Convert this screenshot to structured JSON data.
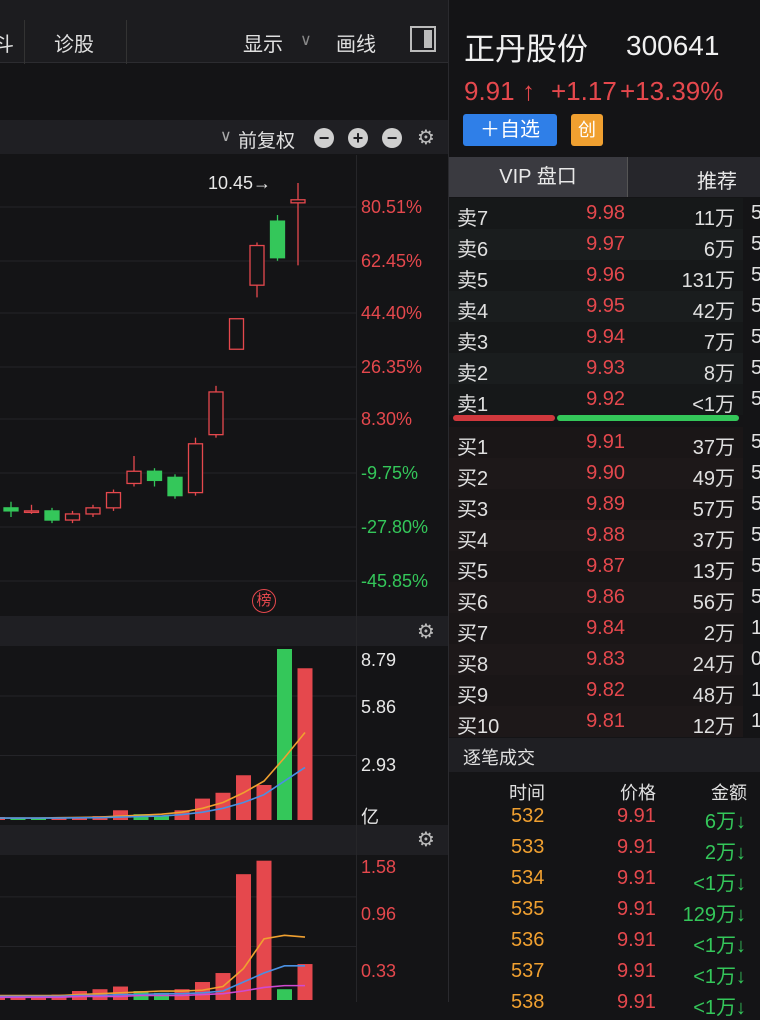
{
  "toolbar": {
    "cut_label": "斗",
    "diagnose": "诊股",
    "display": "显示",
    "draw_line": "画线"
  },
  "chart_header": {
    "adjust": "前复权"
  },
  "stock": {
    "name": "正丹股份",
    "code": "300641",
    "price": "9.91",
    "arrow": "↑",
    "change": "+1.17",
    "pct": "+13.39%",
    "add_watch": "＋自选",
    "badge": "创"
  },
  "kchart_axis": [
    "80.51%",
    "62.45%",
    "44.40%",
    "26.35%",
    "8.30%",
    "-9.75%",
    "-27.80%",
    "-45.85%"
  ],
  "kchart_high_label": "10.45→",
  "bang_label": "榜",
  "vol_axis": [
    "8.79",
    "5.86",
    "2.93",
    "亿"
  ],
  "ind_axis": [
    "1.58",
    "0.96",
    "0.33"
  ],
  "tabs": {
    "vip": "VIP 盘口",
    "recommend": "推荐"
  },
  "orderbook": {
    "sell": [
      {
        "label": "卖7",
        "price": "9.98",
        "vol": "11万",
        "cut": "5"
      },
      {
        "label": "卖6",
        "price": "9.97",
        "vol": "6万",
        "cut": "5"
      },
      {
        "label": "卖5",
        "price": "9.96",
        "vol": "131万",
        "cut": "5"
      },
      {
        "label": "卖4",
        "price": "9.95",
        "vol": "42万",
        "cut": "5"
      },
      {
        "label": "卖3",
        "price": "9.94",
        "vol": "7万",
        "cut": "5"
      },
      {
        "label": "卖2",
        "price": "9.93",
        "vol": "8万",
        "cut": "5"
      },
      {
        "label": "卖1",
        "price": "9.92",
        "vol": "<1万",
        "cut": "5"
      }
    ],
    "buy": [
      {
        "label": "买1",
        "price": "9.91",
        "vol": "37万",
        "cut": "5"
      },
      {
        "label": "买2",
        "price": "9.90",
        "vol": "49万",
        "cut": "5"
      },
      {
        "label": "买3",
        "price": "9.89",
        "vol": "57万",
        "cut": "5"
      },
      {
        "label": "买4",
        "price": "9.88",
        "vol": "37万",
        "cut": "5"
      },
      {
        "label": "买5",
        "price": "9.87",
        "vol": "13万",
        "cut": "5"
      },
      {
        "label": "买6",
        "price": "9.86",
        "vol": "56万",
        "cut": "5"
      },
      {
        "label": "买7",
        "price": "9.84",
        "vol": "2万",
        "cut": "1"
      },
      {
        "label": "买8",
        "price": "9.83",
        "vol": "24万",
        "cut": "0"
      },
      {
        "label": "买9",
        "price": "9.82",
        "vol": "48万",
        "cut": "1"
      },
      {
        "label": "买10",
        "price": "9.81",
        "vol": "12万",
        "cut": "1"
      }
    ]
  },
  "ticks": {
    "title": "逐笔成交",
    "headers": {
      "time": "时间",
      "price": "价格",
      "amount": "金额"
    },
    "rows": [
      {
        "time": "532",
        "price": "9.91",
        "amount": "6万↓"
      },
      {
        "time": "533",
        "price": "9.91",
        "amount": "2万↓"
      },
      {
        "time": "534",
        "price": "9.91",
        "amount": "<1万↓"
      },
      {
        "time": "535",
        "price": "9.91",
        "amount": "129万↓"
      },
      {
        "time": "536",
        "price": "9.91",
        "amount": "<1万↓"
      },
      {
        "time": "537",
        "price": "9.91",
        "amount": "<1万↓"
      },
      {
        "time": "538",
        "price": "9.91",
        "amount": "<1万↓"
      }
    ]
  },
  "colors": {
    "up": "#e5484d",
    "down": "#34c75a",
    "accent": "#2f7fe8",
    "badge": "#f0a030"
  },
  "chart_data": [
    {
      "type": "candlestick",
      "y_axis_labels": [
        "80.51%",
        "62.45%",
        "44.40%",
        "26.35%",
        "8.30%",
        "-9.75%",
        "-27.80%",
        "-45.85%"
      ],
      "annotation": "10.45→",
      "candles": [
        {
          "o": 8.32,
          "c": 8.3,
          "h": 8.36,
          "l": 8.26,
          "dir": "down"
        },
        {
          "o": 8.3,
          "c": 8.3,
          "h": 8.34,
          "l": 8.28,
          "dir": "flat"
        },
        {
          "o": 8.3,
          "c": 8.24,
          "h": 8.32,
          "l": 8.22,
          "dir": "down"
        },
        {
          "o": 8.24,
          "c": 8.28,
          "h": 8.3,
          "l": 8.22,
          "dir": "up"
        },
        {
          "o": 8.28,
          "c": 8.32,
          "h": 8.34,
          "l": 8.26,
          "dir": "up"
        },
        {
          "o": 8.32,
          "c": 8.42,
          "h": 8.44,
          "l": 8.3,
          "dir": "up"
        },
        {
          "o": 8.48,
          "c": 8.56,
          "h": 8.66,
          "l": 8.46,
          "dir": "up"
        },
        {
          "o": 8.56,
          "c": 8.5,
          "h": 8.58,
          "l": 8.46,
          "dir": "down"
        },
        {
          "o": 8.52,
          "c": 8.4,
          "h": 8.54,
          "l": 8.38,
          "dir": "down"
        },
        {
          "o": 8.42,
          "c": 8.74,
          "h": 8.78,
          "l": 8.4,
          "dir": "up"
        },
        {
          "o": 8.8,
          "c": 9.08,
          "h": 9.12,
          "l": 8.78,
          "dir": "up"
        },
        {
          "o": 9.36,
          "c": 9.56,
          "h": 9.56,
          "l": 9.36,
          "dir": "up"
        },
        {
          "o": 9.78,
          "c": 10.04,
          "h": 10.06,
          "l": 9.7,
          "dir": "up"
        },
        {
          "o": 10.2,
          "c": 9.96,
          "h": 10.24,
          "l": 9.94,
          "dir": "down"
        },
        {
          "o": 10.32,
          "c": 10.34,
          "h": 10.45,
          "l": 9.91,
          "dir": "up"
        }
      ]
    },
    {
      "type": "bar",
      "y_axis_labels": [
        "8.79",
        "5.86",
        "2.93",
        "亿"
      ],
      "ylim": [
        0,
        8.79
      ],
      "values": [
        0.15,
        0.1,
        0.1,
        0.1,
        0.15,
        0.2,
        0.5,
        0.3,
        0.2,
        0.5,
        1.1,
        1.4,
        2.3,
        1.8,
        8.79,
        7.8
      ],
      "dirs": [
        "up",
        "down",
        "down",
        "up",
        "up",
        "up",
        "up",
        "down",
        "down",
        "up",
        "up",
        "up",
        "up",
        "up",
        "down",
        "up"
      ],
      "ma_lines": [
        {
          "color": "#f0a030",
          "values": [
            0.1,
            0.1,
            0.1,
            0.12,
            0.13,
            0.15,
            0.2,
            0.25,
            0.3,
            0.4,
            0.6,
            0.9,
            1.4,
            2.0,
            3.2,
            4.5
          ]
        },
        {
          "color": "#4a90e2",
          "values": [
            0.1,
            0.1,
            0.1,
            0.1,
            0.11,
            0.12,
            0.15,
            0.18,
            0.2,
            0.28,
            0.4,
            0.6,
            0.9,
            1.3,
            2.0,
            2.7
          ]
        }
      ]
    },
    {
      "type": "bar",
      "y_axis_labels": [
        "1.58",
        "0.96",
        "0.33"
      ],
      "ylim": [
        0,
        1.58
      ],
      "values": [
        0.05,
        0.05,
        0.05,
        0.06,
        0.1,
        0.12,
        0.15,
        0.1,
        0.08,
        0.12,
        0.2,
        0.3,
        1.4,
        1.55,
        0.12,
        0.4
      ],
      "dirs": [
        "up",
        "up",
        "up",
        "up",
        "up",
        "up",
        "up",
        "down",
        "down",
        "up",
        "up",
        "up",
        "up",
        "up",
        "down",
        "up"
      ],
      "ma_lines": [
        {
          "color": "#f0a030",
          "values": [
            0.05,
            0.05,
            0.05,
            0.05,
            0.06,
            0.07,
            0.08,
            0.09,
            0.1,
            0.1,
            0.11,
            0.15,
            0.35,
            0.68,
            0.72,
            0.7
          ]
        },
        {
          "color": "#4a90e2",
          "values": [
            0.04,
            0.04,
            0.04,
            0.04,
            0.05,
            0.05,
            0.06,
            0.06,
            0.07,
            0.07,
            0.08,
            0.1,
            0.2,
            0.3,
            0.38,
            0.38
          ]
        },
        {
          "color": "#d04ad0",
          "values": [
            0.03,
            0.03,
            0.03,
            0.03,
            0.04,
            0.04,
            0.04,
            0.05,
            0.05,
            0.05,
            0.06,
            0.07,
            0.1,
            0.14,
            0.16,
            0.16
          ]
        }
      ]
    }
  ]
}
